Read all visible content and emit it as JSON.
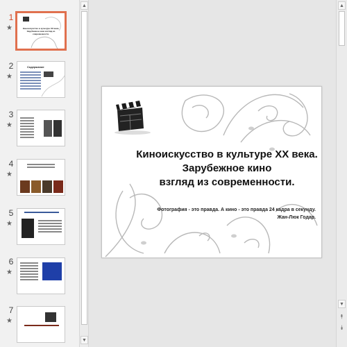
{
  "thumbnails": [
    {
      "number": "1",
      "title": "Киноискусство в культуре ХХ века. Зарубежное кино взгляд из современности.",
      "active": true
    },
    {
      "number": "2",
      "title": "Содержание",
      "active": false
    },
    {
      "number": "3",
      "title": "",
      "active": false
    },
    {
      "number": "4",
      "title": "",
      "active": false
    },
    {
      "number": "5",
      "title": "",
      "active": false
    },
    {
      "number": "6",
      "title": "",
      "active": false
    },
    {
      "number": "7",
      "title": "",
      "active": false
    }
  ],
  "transition_glyph": "★",
  "scroll_up_glyph": "▲",
  "scroll_down_glyph": "▼",
  "prev_slide_glyph": "⯭",
  "next_slide_glyph": "⯯",
  "slide": {
    "title_line1": "Киноискусство в культуре ХХ века.",
    "title_line2": "Зарубежное кино",
    "title_line3": "взгляд из современности.",
    "quote": "Фотография - это правда. А кино - это правда 24 кадра в секунду.",
    "quote_author": "Жан-Люк Годар."
  },
  "colors": {
    "active_border": "#e0704e",
    "active_number": "#d24726"
  }
}
